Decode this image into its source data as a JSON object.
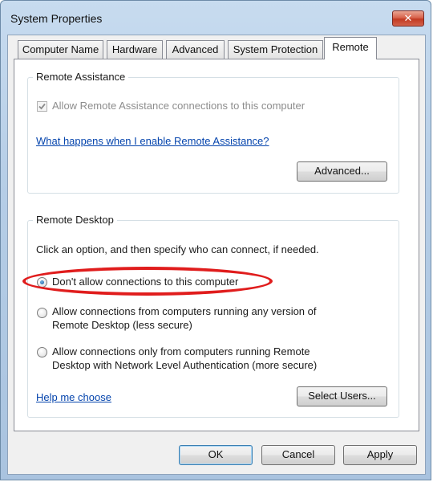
{
  "window": {
    "title": "System Properties",
    "close_glyph": "✕"
  },
  "tabs": [
    {
      "label": "Computer Name",
      "active": false
    },
    {
      "label": "Hardware",
      "active": false
    },
    {
      "label": "Advanced",
      "active": false
    },
    {
      "label": "System Protection",
      "active": false
    },
    {
      "label": "Remote",
      "active": true
    }
  ],
  "remote_assistance": {
    "legend": "Remote Assistance",
    "checkbox_label": "Allow Remote Assistance connections to this computer",
    "checkbox_checked": true,
    "checkbox_disabled": true,
    "help_link": "What happens when I enable Remote Assistance?",
    "advanced_button": "Advanced..."
  },
  "remote_desktop": {
    "legend": "Remote Desktop",
    "instruction": "Click an option, and then specify who can connect, if needed.",
    "options": [
      {
        "line1": "Don't allow connections to this computer",
        "line2": "",
        "selected": true
      },
      {
        "line1": "Allow connections from computers running any version of",
        "line2": "Remote Desktop (less secure)",
        "selected": false
      },
      {
        "line1": "Allow connections only from computers running Remote",
        "line2": "Desktop with Network Level Authentication (more secure)",
        "selected": false
      }
    ],
    "help_link": "Help me choose",
    "select_users_button": "Select Users..."
  },
  "footer": {
    "ok": "OK",
    "cancel": "Cancel",
    "apply": "Apply"
  },
  "colors": {
    "annotation_ellipse": "#e01d1d",
    "link": "#0645ad"
  }
}
